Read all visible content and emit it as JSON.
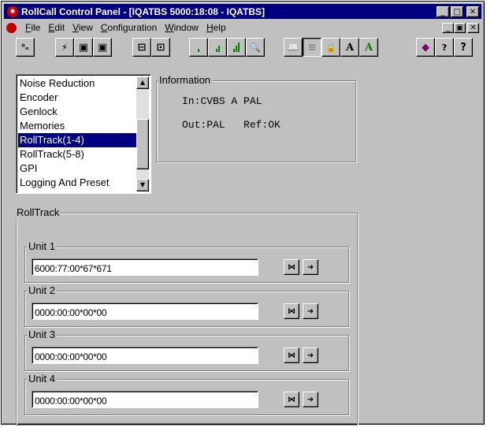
{
  "window": {
    "title": "RollCall Control Panel - [IQATBS 5000:18:08 - IQATBS]",
    "title_icon": "rollcall-app-icon",
    "controls": {
      "minimize": "_",
      "maximize": "□",
      "close": "✕"
    }
  },
  "menubar": {
    "items": [
      {
        "label": "File",
        "accel": "F"
      },
      {
        "label": "Edit",
        "accel": "E"
      },
      {
        "label": "View",
        "accel": "V"
      },
      {
        "label": "Configuration",
        "accel": "C"
      },
      {
        "label": "Window",
        "accel": "W"
      },
      {
        "label": "Help",
        "accel": "H"
      }
    ],
    "mdi_controls": {
      "minimize": "_",
      "restore": "▣",
      "close": "✕"
    }
  },
  "toolbar": {
    "buttons": [
      {
        "icon": "connect-icon",
        "glyph": "⁰ₒ"
      },
      {
        "icon": "lightning-icon",
        "glyph": "⚡"
      },
      {
        "icon": "save-icon",
        "glyph": "▣"
      },
      {
        "icon": "save-all-icon",
        "glyph": "▣"
      },
      {
        "icon": "load-icon",
        "glyph": "⊟"
      },
      {
        "icon": "clipboard-icon",
        "glyph": "⊡"
      },
      {
        "icon": "signal-low-icon",
        "glyph": ""
      },
      {
        "icon": "signal-mid-icon",
        "glyph": ""
      },
      {
        "icon": "signal-high-icon",
        "glyph": ""
      },
      {
        "icon": "search-icon",
        "glyph": "🔍"
      },
      {
        "icon": "book-icon",
        "glyph": "📖"
      },
      {
        "icon": "notepad-icon",
        "glyph": "≡"
      },
      {
        "icon": "lock-icon",
        "glyph": "🔒"
      },
      {
        "icon": "font-a-black-icon",
        "glyph": "A"
      },
      {
        "icon": "font-a-green-icon",
        "glyph": "A"
      },
      {
        "icon": "help-book-icon",
        "glyph": "◆"
      },
      {
        "icon": "window-help-icon",
        "glyph": "?"
      },
      {
        "icon": "question-mark-icon",
        "glyph": "?"
      }
    ],
    "colors": {
      "green": "#008000",
      "black": "#000000"
    }
  },
  "menu_list": {
    "items": [
      "Noise Reduction",
      "Encoder",
      "Genlock",
      "Memories",
      "RollTrack(1-4)",
      "RollTrack(5-8)",
      "GPI",
      "Logging And Preset"
    ],
    "selected_index": 4
  },
  "information": {
    "label": "Information",
    "line1": "In:CVBS A PAL",
    "line2": "Out:PAL   Ref:OK"
  },
  "rolltrack": {
    "label": "RollTrack",
    "units": [
      {
        "label": "Unit 1",
        "value": "6000:77:00*67*671"
      },
      {
        "label": "Unit 2",
        "value": "0000:00:00*00*00"
      },
      {
        "label": "Unit 3",
        "value": "0000:00:00*00*00"
      },
      {
        "label": "Unit 4",
        "value": "0000:00:00*00*00"
      }
    ],
    "button_glyphs": {
      "jump": "⋈",
      "send": "➜"
    }
  },
  "colors": {
    "face": "#c0c0c0",
    "titlebar": "#000080",
    "selection": "#000080",
    "app_icon": "#c00000"
  }
}
